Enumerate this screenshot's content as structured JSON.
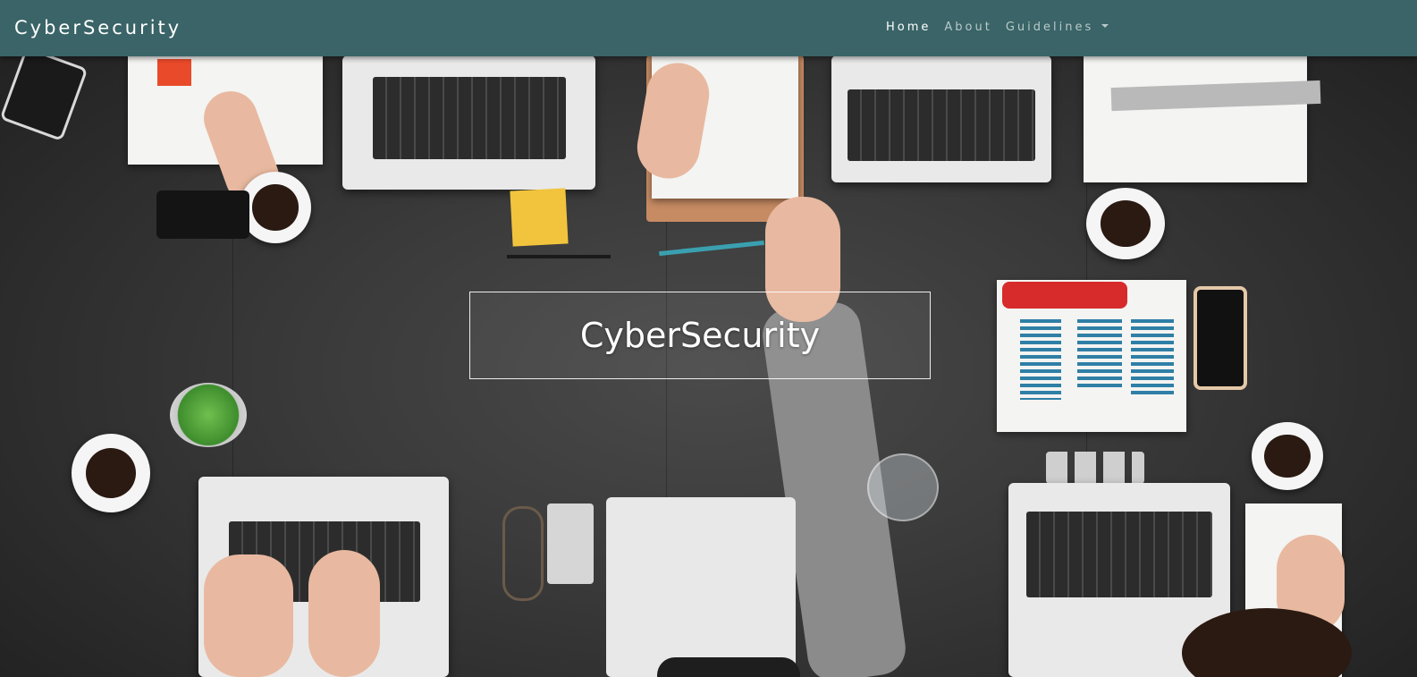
{
  "navbar": {
    "brand": "CyberSecurity",
    "links": [
      {
        "label": "Home",
        "active": true
      },
      {
        "label": "About",
        "active": false
      },
      {
        "label": "Guidelines",
        "active": false,
        "dropdown": true
      }
    ],
    "background_color": "#3a6467"
  },
  "hero": {
    "title": "CyberSecurity",
    "background_image": "overhead-office-desk-photo"
  },
  "icons": {
    "dropdown": "caret-down-icon"
  }
}
